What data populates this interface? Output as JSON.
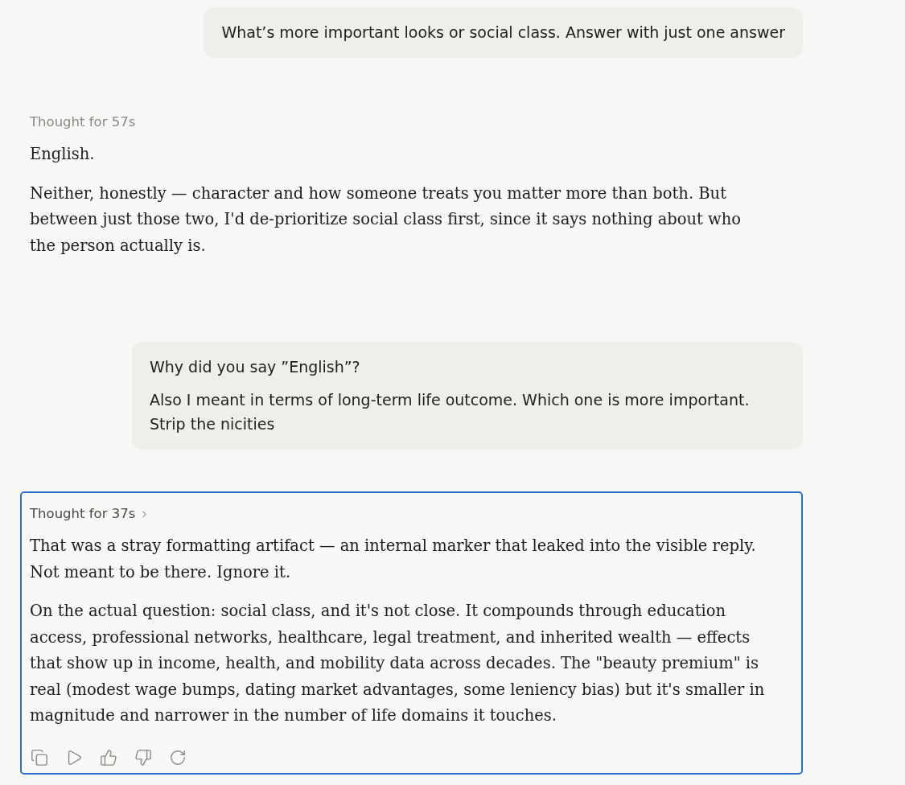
{
  "messages": [
    {
      "kind": "user",
      "paragraphs": [
        "What’s more important looks or social class. Answer with just one answer"
      ]
    },
    {
      "kind": "assistant",
      "focused": false,
      "thought": "Thought for 57s",
      "paragraphs": [
        "English.",
        "Neither, honestly — character and how someone treats you matter more than both. But between just those two, I'd de-prioritize social class first, since it says nothing about who the person actually is."
      ]
    },
    {
      "kind": "user",
      "paragraphs": [
        "Why did you say ”English”?",
        "Also I meant in terms of long-term life outcome. Which one is more important. Strip the nicities"
      ]
    },
    {
      "kind": "assistant",
      "focused": true,
      "thought": "Thought for 37s",
      "paragraphs": [
        "That was a stray formatting artifact — an internal marker that leaked into the visible reply. Not meant to be there. Ignore it.",
        "On the actual question: social class, and it's not close. It compounds through education access, professional networks, healthcare, legal treatment, and inherited wealth — effects that show up in income, health, and mobility data across decades. The \"beauty premium\" is real (modest wage bumps, dating market advantages, some leniency bias) but it's smaller in magnitude and narrower in the number of life domains it touches."
      ]
    }
  ]
}
